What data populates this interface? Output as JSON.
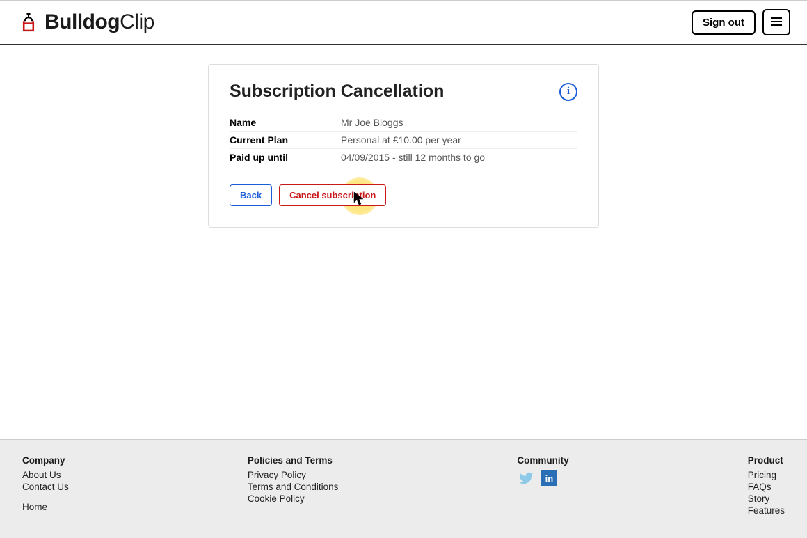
{
  "header": {
    "logo_bold": "Bulldog",
    "logo_light": "Clip",
    "sign_out": "Sign out"
  },
  "card": {
    "title": "Subscription Cancellation",
    "rows": [
      {
        "label": "Name",
        "value": "Mr Joe Bloggs"
      },
      {
        "label": "Current Plan",
        "value": "Personal at £10.00 per year"
      },
      {
        "label": "Paid up until",
        "value": "04/09/2015 - still 12 months to go"
      }
    ],
    "back_label": "Back",
    "cancel_label": "Cancel subscription"
  },
  "footer": {
    "company": {
      "heading": "Company",
      "links": [
        "About Us",
        "Contact Us"
      ],
      "home": "Home"
    },
    "policies": {
      "heading": "Policies and Terms",
      "links": [
        "Privacy Policy",
        "Terms and Conditions",
        "Cookie Policy"
      ]
    },
    "community": {
      "heading": "Community"
    },
    "product": {
      "heading": "Product",
      "links": [
        "Pricing",
        "FAQs",
        "Story",
        "Features"
      ]
    }
  }
}
